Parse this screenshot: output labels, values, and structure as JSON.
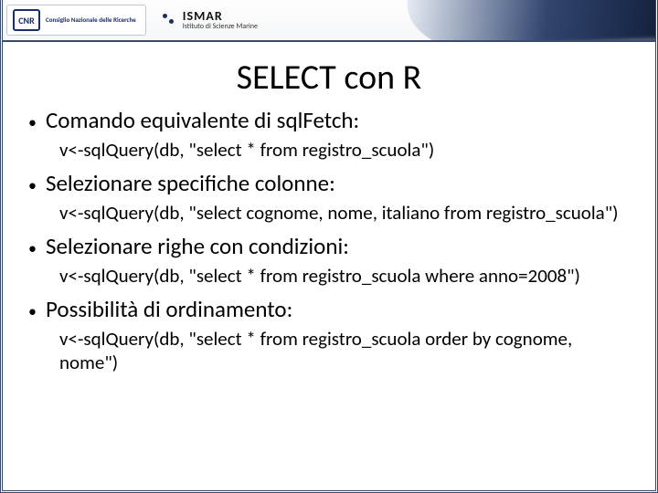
{
  "header": {
    "cnr_mark": "CNR",
    "cnr_sub": "Consiglio Nazionale\ndelle Ricerche",
    "ismar": "ISMAR",
    "ismar_sub": "Istituto di Scienze Marine"
  },
  "title": "SELECT con R",
  "bullets": [
    {
      "text": "Comando equivalente di sqlFetch:",
      "code": "v<-sqlQuery(db, \"select * from registro_scuola\")"
    },
    {
      "text": "Selezionare specifiche colonne:",
      "code": "v<-sqlQuery(db, \"select cognome, nome, italiano from registro_scuola\")"
    },
    {
      "text": "Selezionare righe con condizioni:",
      "code": "v<-sqlQuery(db, \"select * from registro_scuola where anno=2008\")"
    },
    {
      "text": "Possibilità di ordinamento:",
      "code": "v<-sqlQuery(db, \"select * from registro_scuola order by cognome, nome\")"
    }
  ]
}
